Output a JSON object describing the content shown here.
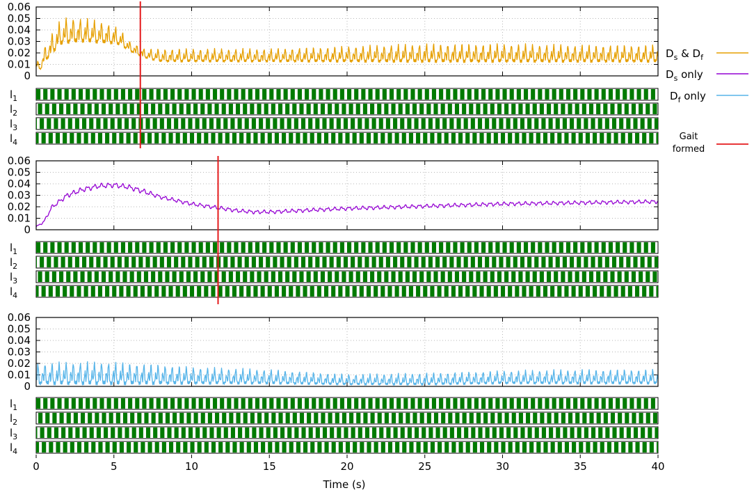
{
  "figure": {
    "xlabel": "Time (s)",
    "xticks": [
      "0",
      "5",
      "10",
      "15",
      "20",
      "25",
      "30",
      "35",
      "40"
    ],
    "yticks": [
      "0",
      "0.01",
      "0.02",
      "0.03",
      "0.04",
      "0.05",
      "0.06"
    ],
    "leg_labels": [
      "l",
      "l",
      "l",
      "l"
    ],
    "leg_subs": [
      "1",
      "2",
      "3",
      "4"
    ],
    "legend": {
      "items": [
        {
          "main": "D",
          "sub1": "s",
          "mid": " & D",
          "sub2": "f",
          "color": "#e69f00"
        },
        {
          "main": "D",
          "sub1": "s",
          "mid": " only",
          "sub2": "",
          "color": "#9400d3"
        },
        {
          "main": "D",
          "sub1": "f",
          "mid": " only",
          "sub2": "",
          "color": "#56b4e9"
        }
      ],
      "gait_line1": "Gait",
      "gait_line2": "formed",
      "gait_color": "#e41a1c"
    }
  },
  "chart_data": [
    {
      "type": "line",
      "series_label": "Ds & Df",
      "color": "#e69f00",
      "xlim": [
        0,
        40
      ],
      "ylim": [
        0,
        0.06
      ],
      "gait_formed_time": 6.7,
      "envelope_t": [
        0,
        0.3,
        0.5,
        1,
        1.5,
        2,
        3,
        4,
        5,
        5.5,
        6,
        7,
        8,
        10,
        15,
        20,
        25,
        30,
        35,
        40
      ],
      "envelope_base": [
        0.008,
        0.006,
        0.012,
        0.02,
        0.028,
        0.03,
        0.031,
        0.03,
        0.029,
        0.027,
        0.022,
        0.016,
        0.013,
        0.013,
        0.013,
        0.013,
        0.013,
        0.013,
        0.013,
        0.013
      ],
      "envelope_amp": [
        0.005,
        0.006,
        0.012,
        0.016,
        0.018,
        0.02,
        0.018,
        0.017,
        0.014,
        0.011,
        0.008,
        0.007,
        0.01,
        0.01,
        0.01,
        0.012,
        0.014,
        0.014,
        0.013,
        0.013
      ],
      "oscillation_hz": 2.2,
      "gait_phase_offsets": [
        0,
        0.25,
        0.5,
        0.75
      ]
    },
    {
      "type": "line",
      "series_label": "Ds only",
      "color": "#9400d3",
      "xlim": [
        0,
        40
      ],
      "ylim": [
        0,
        0.06
      ],
      "gait_formed_time": 11.7,
      "envelope_t": [
        0,
        0.5,
        1,
        2,
        3,
        4,
        5,
        6,
        7,
        8,
        9,
        10,
        12,
        13,
        14,
        15,
        20,
        25,
        30,
        35,
        40
      ],
      "envelope_base": [
        0.002,
        0.006,
        0.018,
        0.028,
        0.033,
        0.036,
        0.037,
        0.035,
        0.031,
        0.027,
        0.024,
        0.021,
        0.017,
        0.015,
        0.014,
        0.014,
        0.017,
        0.019,
        0.021,
        0.022,
        0.023
      ],
      "envelope_amp": [
        0.001,
        0.002,
        0.003,
        0.004,
        0.004,
        0.004,
        0.004,
        0.004,
        0.004,
        0.003,
        0.003,
        0.003,
        0.003,
        0.003,
        0.003,
        0.003,
        0.003,
        0.003,
        0.003,
        0.003,
        0.003
      ],
      "oscillation_hz": 2.2,
      "gait_phase_offsets": [
        0,
        0.5,
        0.25,
        0.75
      ]
    },
    {
      "type": "line",
      "series_label": "Df only",
      "color": "#56b4e9",
      "xlim": [
        0,
        40
      ],
      "ylim": [
        0,
        0.06
      ],
      "gait_formed_time": null,
      "envelope_t": [
        0,
        2,
        5,
        8,
        10,
        15,
        20,
        25,
        30,
        35,
        40
      ],
      "envelope_base": [
        0.003,
        0.003,
        0.003,
        0.003,
        0.003,
        0.003,
        0.002,
        0.002,
        0.003,
        0.003,
        0.003
      ],
      "envelope_amp": [
        0.016,
        0.017,
        0.017,
        0.015,
        0.013,
        0.011,
        0.008,
        0.009,
        0.01,
        0.011,
        0.011
      ],
      "oscillation_hz": 2.2,
      "gait_phase_offsets": [
        0,
        0.3,
        0.55,
        0.8
      ]
    }
  ]
}
